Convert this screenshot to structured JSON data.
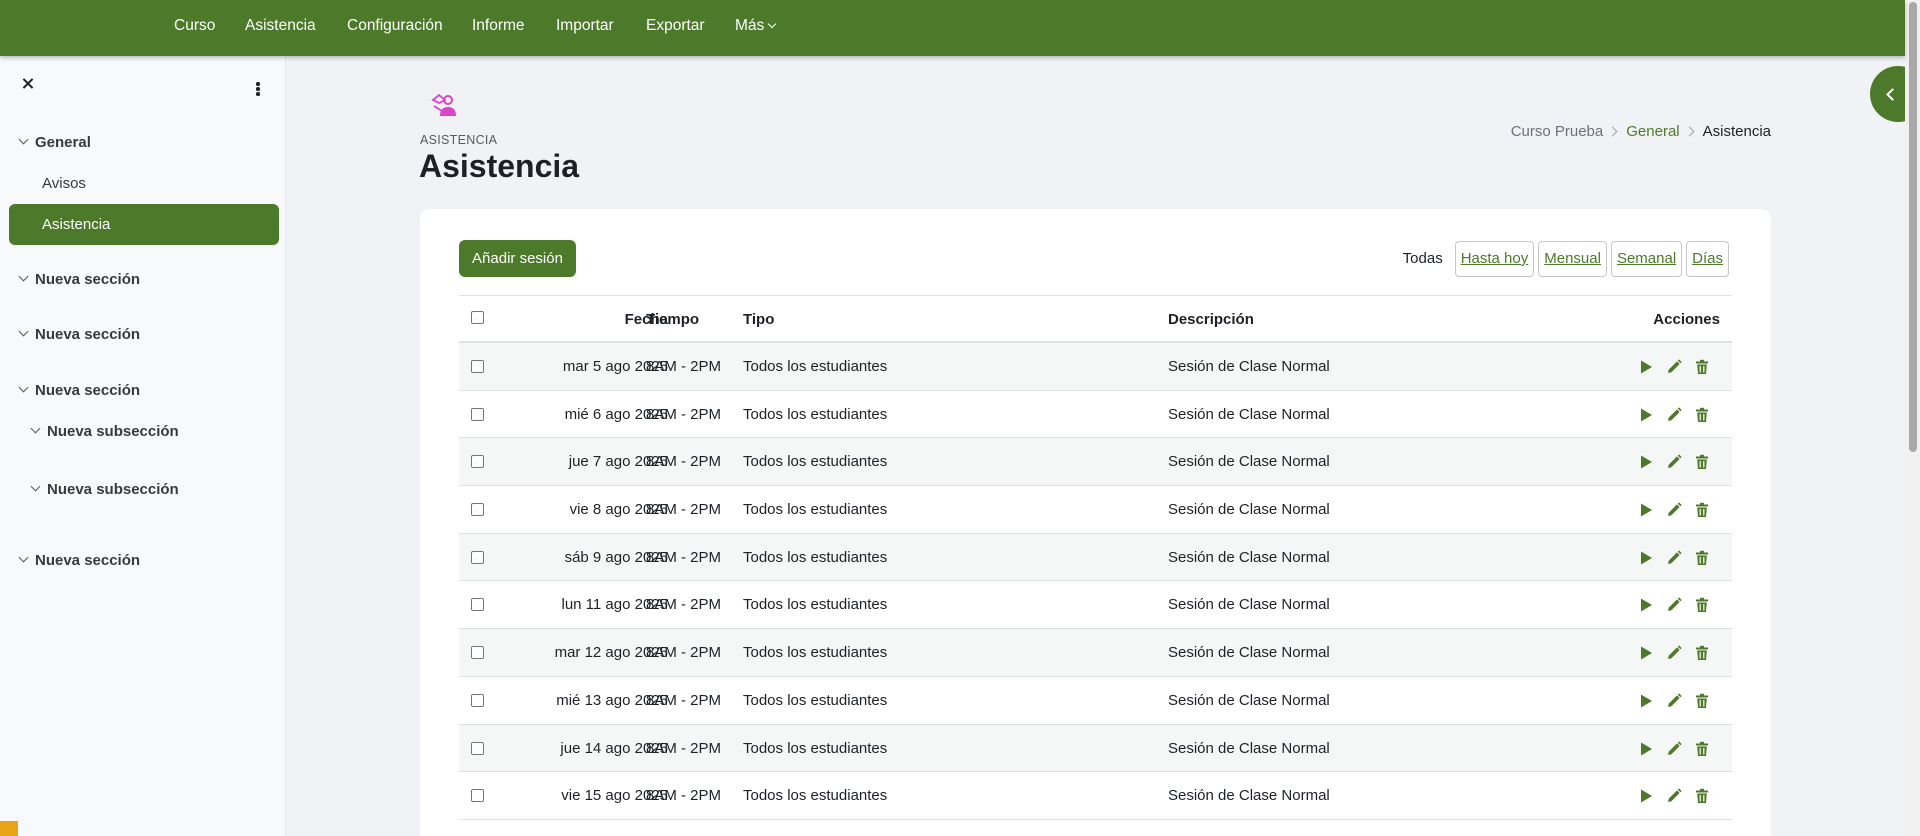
{
  "topnav": {
    "items": [
      "Curso",
      "Asistencia",
      "Configuración",
      "Informe",
      "Importar",
      "Exportar",
      "Más"
    ]
  },
  "drawer": {
    "sections": [
      {
        "label": "General",
        "items": [
          "Avisos",
          "Asistencia"
        ]
      },
      {
        "label": "Nueva sección"
      },
      {
        "label": "Nueva sección"
      },
      {
        "label": "Nueva sección",
        "subsections": [
          "Nueva subsección",
          "Nueva subsección"
        ]
      },
      {
        "label": "Nueva sección"
      }
    ],
    "active_item": "Asistencia"
  },
  "header": {
    "activity_kind": "ASISTENCIA",
    "title": "Asistencia",
    "breadcrumb": [
      "Curso Prueba",
      "General",
      "Asistencia"
    ]
  },
  "toolbar": {
    "add_label": "Añadir sesión",
    "filter_active": "Todas",
    "filters": [
      "Hasta hoy",
      "Mensual",
      "Semanal",
      "Días"
    ]
  },
  "table": {
    "headers": {
      "date": "Fecha",
      "time": "Tiempo",
      "type": "Tipo",
      "description": "Descripción",
      "actions": "Acciones"
    },
    "rows": [
      {
        "date": "mar 5 ago 2025",
        "time": "8AM - 2PM",
        "type": "Todos los estudiantes",
        "description": "Sesión de Clase Normal"
      },
      {
        "date": "mié 6 ago 2025",
        "time": "8AM - 2PM",
        "type": "Todos los estudiantes",
        "description": "Sesión de Clase Normal"
      },
      {
        "date": "jue 7 ago 2025",
        "time": "8AM - 2PM",
        "type": "Todos los estudiantes",
        "description": "Sesión de Clase Normal"
      },
      {
        "date": "vie 8 ago 2025",
        "time": "8AM - 2PM",
        "type": "Todos los estudiantes",
        "description": "Sesión de Clase Normal"
      },
      {
        "date": "sáb 9 ago 2025",
        "time": "8AM - 2PM",
        "type": "Todos los estudiantes",
        "description": "Sesión de Clase Normal"
      },
      {
        "date": "lun 11 ago 2025",
        "time": "8AM - 2PM",
        "type": "Todos los estudiantes",
        "description": "Sesión de Clase Normal"
      },
      {
        "date": "mar 12 ago 2025",
        "time": "8AM - 2PM",
        "type": "Todos los estudiantes",
        "description": "Sesión de Clase Normal"
      },
      {
        "date": "mié 13 ago 2025",
        "time": "8AM - 2PM",
        "type": "Todos los estudiantes",
        "description": "Sesión de Clase Normal"
      },
      {
        "date": "jue 14 ago 2025",
        "time": "8AM - 2PM",
        "type": "Todos los estudiantes",
        "description": "Sesión de Clase Normal"
      },
      {
        "date": "vie 15 ago 2025",
        "time": "8AM - 2PM",
        "type": "Todos los estudiantes",
        "description": "Sesión de Clase Normal"
      }
    ]
  },
  "colors": {
    "brand": "#4d7a2a",
    "activity_icon": "#d946c8"
  },
  "icons": {
    "row_actions": [
      "play-icon",
      "pencil-icon",
      "trash-icon"
    ],
    "activity": "attendance-icon"
  }
}
